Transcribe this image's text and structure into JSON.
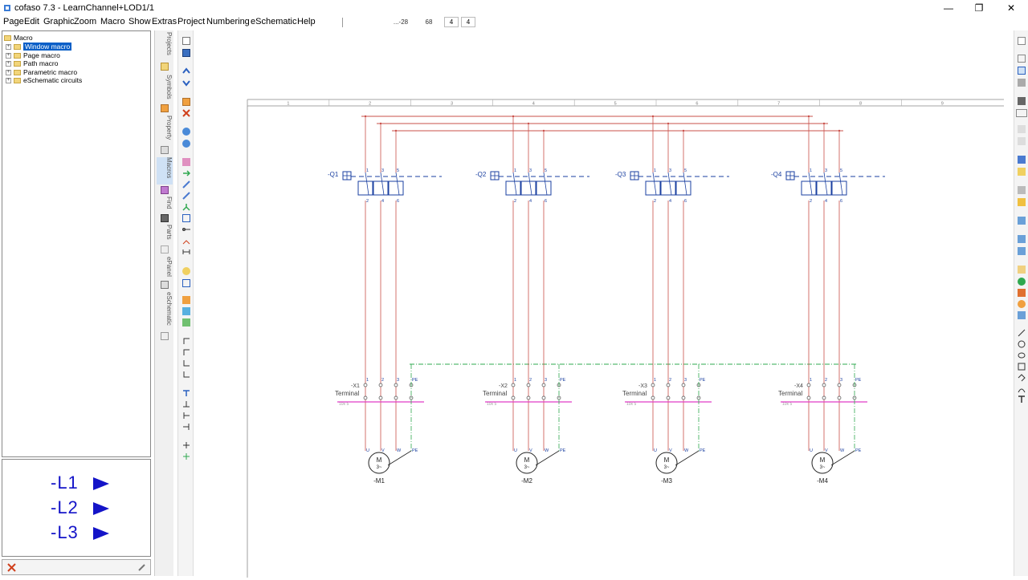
{
  "window": {
    "title": "cofaso 7.3 - LearnChannel+LOD1/1",
    "minimize": "—",
    "restore": "❐",
    "close": "✕"
  },
  "menu": [
    "Page",
    "Edit",
    "Graphic",
    "Zoom",
    "Macro",
    "Show",
    "Extras",
    "Project",
    "Numbering",
    "eSchematic",
    "Help"
  ],
  "statusbar": {
    "coord_x": "...-28",
    "coord_y": "68",
    "field1": "4",
    "field2": "4"
  },
  "tree": {
    "root": "Macro",
    "items": [
      "Window macro",
      "Page macro",
      "Path macro",
      "Parametric macro",
      "eSchematic circuits"
    ],
    "selected": "Window macro"
  },
  "preview": {
    "labels": [
      "-L1",
      "-L2",
      "-L3"
    ]
  },
  "side_tabs": [
    "Projects",
    "Symbols",
    "Property",
    "Macros",
    "Find",
    "Parts",
    "ePanel",
    "eSchematic"
  ],
  "schematic": {
    "column_numbers": [
      "1",
      "2",
      "3",
      "4",
      "5",
      "6",
      "7",
      "8",
      "9"
    ],
    "breakers": [
      "-Q1",
      "-Q2",
      "-Q3",
      "-Q4"
    ],
    "terminals": [
      "-X1",
      "-X2",
      "-X3",
      "-X4"
    ],
    "terminal_label": "Terminal",
    "terminal_size": "10x 5",
    "motors": [
      "-M1",
      "-M2",
      "-M3",
      "-M4"
    ],
    "motor_symbol": "M",
    "motor_phase": "3~",
    "contact_top": [
      "1",
      "3",
      "5"
    ],
    "contact_bottom": [
      "2",
      "4",
      "6"
    ],
    "terminal_pins": [
      "1",
      "2",
      "3",
      "PE"
    ],
    "motor_pins": [
      "U",
      "V",
      "W",
      "PE"
    ]
  },
  "colors": {
    "accent_blue": "#0a5fc7",
    "symbol_blue": "#1a3fa0",
    "wire_red": "#c9504a",
    "wire_green": "#2fa84f",
    "wire_magenta": "#e03cc8"
  }
}
